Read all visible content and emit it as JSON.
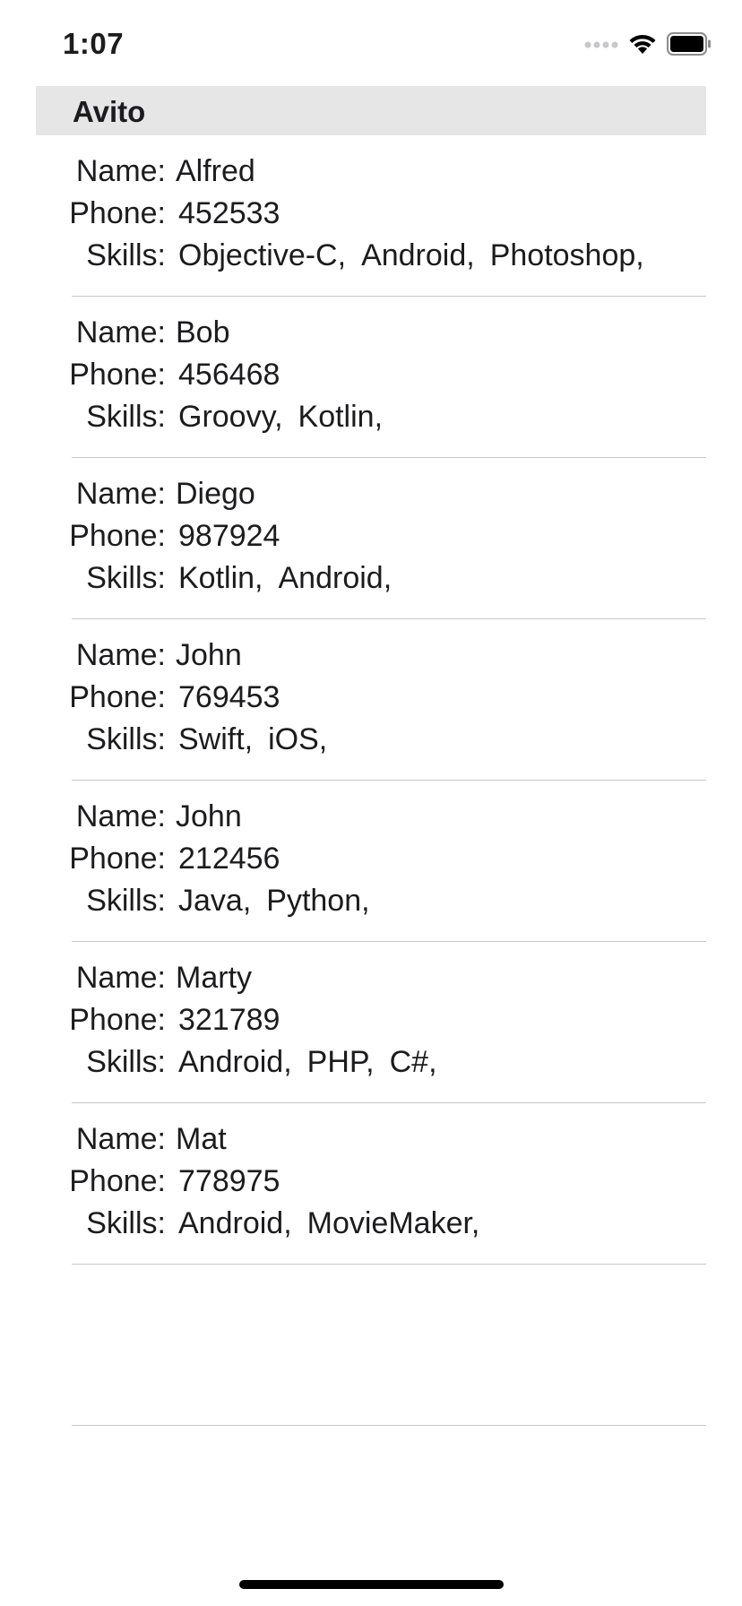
{
  "status_bar": {
    "time": "1:07",
    "icons": [
      "signal-icon",
      "wifi-icon",
      "battery-icon"
    ]
  },
  "header": {
    "title": "Avito"
  },
  "labels": {
    "name": "Name:",
    "phone": "Phone:",
    "skills": "Skills:"
  },
  "contacts": [
    {
      "name": "Alfred",
      "phone": "452533",
      "skills": [
        "Objective-C,",
        "Android,",
        "Photoshop,"
      ]
    },
    {
      "name": "Bob",
      "phone": "456468",
      "skills": [
        "Groovy,",
        "Kotlin,"
      ]
    },
    {
      "name": "Diego",
      "phone": "987924",
      "skills": [
        "Kotlin,",
        "Android,"
      ]
    },
    {
      "name": "John",
      "phone": "769453",
      "skills": [
        "Swift,",
        "iOS,"
      ]
    },
    {
      "name": "John",
      "phone": "212456",
      "skills": [
        "Java,",
        "Python,"
      ]
    },
    {
      "name": "Marty",
      "phone": "321789",
      "skills": [
        "Android,",
        "PHP,",
        "C#,"
      ]
    },
    {
      "name": "Mat",
      "phone": "778975",
      "skills": [
        "Android,",
        "MovieMaker,"
      ]
    }
  ],
  "colors": {
    "header_bg": "#e6e6e6",
    "separator": "#c8c7cc",
    "text": "#1c1c1e"
  }
}
